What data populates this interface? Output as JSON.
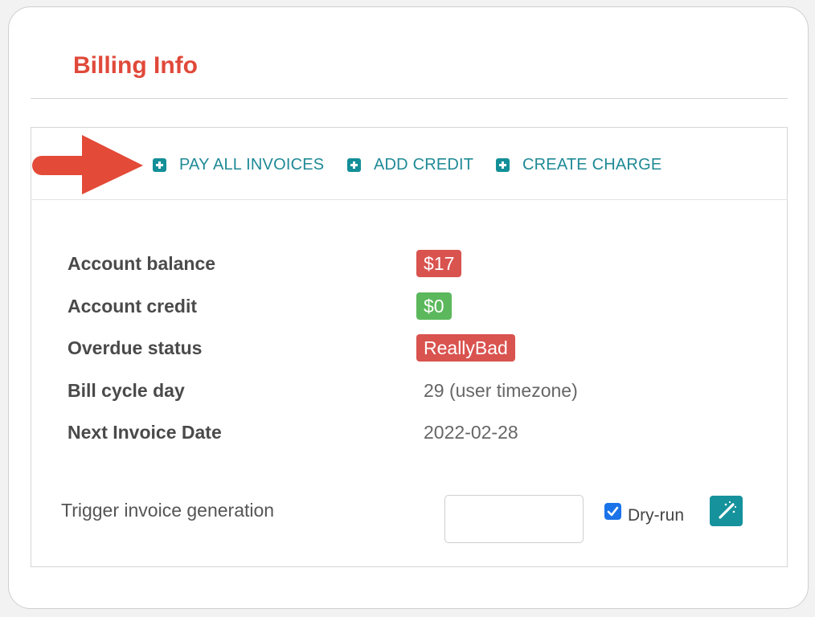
{
  "page": {
    "title": "Billing Info"
  },
  "actions": [
    {
      "label": "PAY ALL INVOICES",
      "icon": "plus-square-icon"
    },
    {
      "label": "ADD CREDIT",
      "icon": "plus-square-icon"
    },
    {
      "label": "CREATE CHARGE",
      "icon": "plus-square-icon"
    }
  ],
  "details": [
    {
      "label": "Account balance",
      "value": "$17",
      "style": "badge",
      "color": "#d9534f"
    },
    {
      "label": "Account credit",
      "value": "$0",
      "style": "badge",
      "color": "#5cb85c"
    },
    {
      "label": "Overdue status",
      "value": "ReallyBad",
      "style": "badge",
      "color": "#d9534f"
    },
    {
      "label": "Bill cycle day",
      "value": "29 (user timezone)",
      "style": "text"
    },
    {
      "label": "Next Invoice Date",
      "value": "2022-02-28",
      "style": "text"
    }
  ],
  "trigger": {
    "label": "Trigger invoice generation",
    "input_value": "",
    "dry_run_label": "Dry-run",
    "dry_run_checked": true,
    "button_icon": "magic-wand-icon"
  },
  "colors": {
    "title": "#e0493a",
    "accent": "#1f8a96",
    "arrow": "#e34a38",
    "danger": "#d9534f",
    "success": "#5cb85c"
  }
}
